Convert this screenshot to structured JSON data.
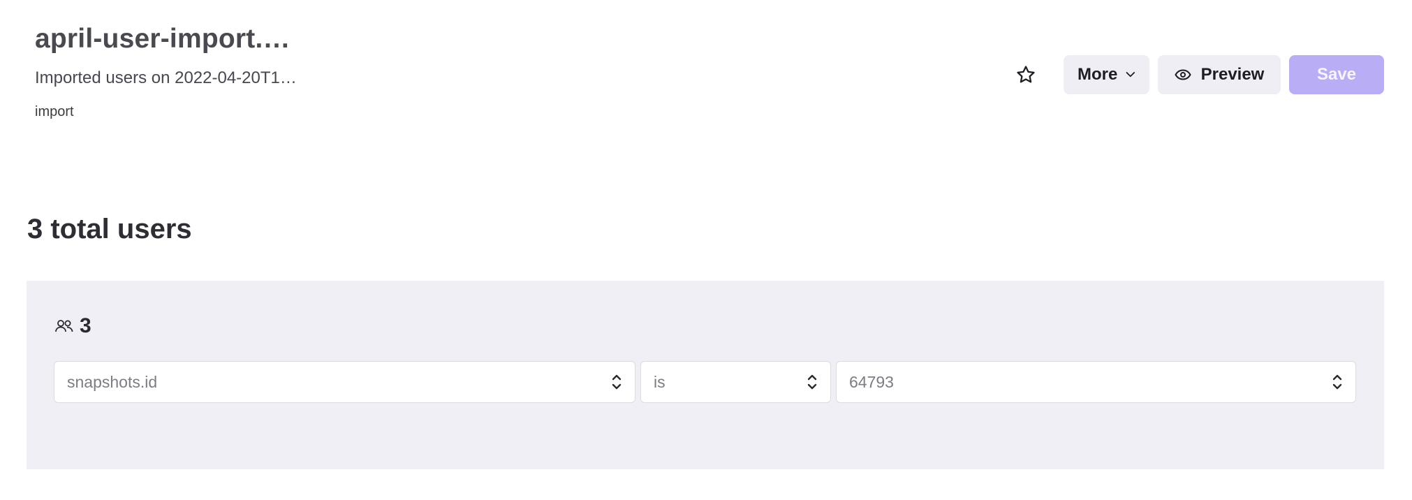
{
  "header": {
    "title": "april-user-import.…",
    "subtitle": "Imported users on 2022-04-20T1…",
    "tag": "import",
    "more_label": "More",
    "preview_label": "Preview",
    "save_label": "Save"
  },
  "summary": {
    "total_label": "3 total users",
    "user_count": "3"
  },
  "filter": {
    "field": "snapshots.id",
    "operator": "is",
    "value": "64793"
  },
  "icons": {
    "star": "star-icon",
    "more": "chevron-down-icon",
    "preview": "eye-icon",
    "users": "users-icon",
    "select": "sort-arrows-icon"
  },
  "colors": {
    "save_button_bg": "#b9adf6",
    "panel_bg": "#f0eff5",
    "secondary_button_bg": "#efeef4"
  }
}
